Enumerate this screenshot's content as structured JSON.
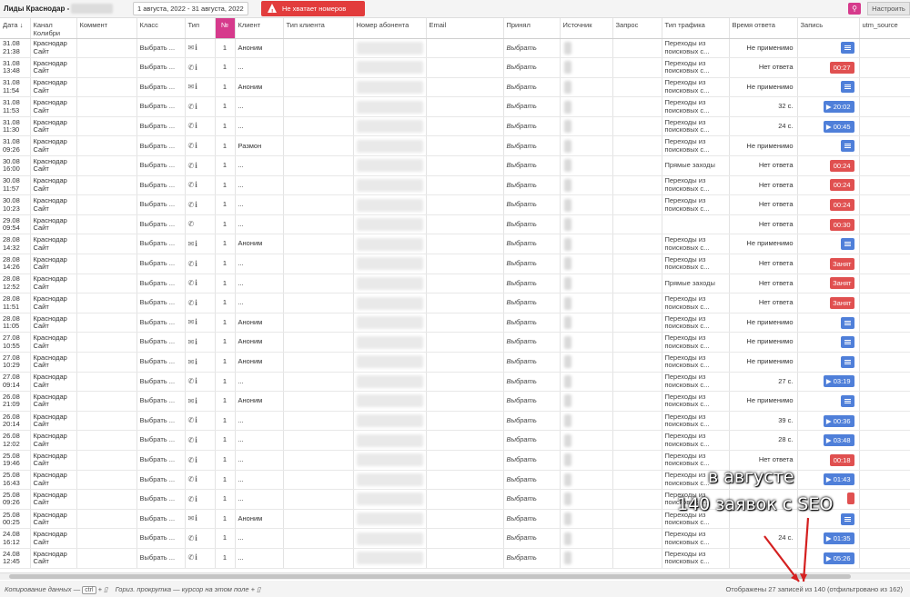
{
  "topbar": {
    "title": "Лиды Краснодар -",
    "date_range": "1 августа, 2022 - 31 августа, 2022",
    "warning": "Не хватает номеров",
    "settings": "Настроить"
  },
  "columns": [
    "Дата ↓",
    "Канал Колибри",
    "Коммент",
    "Класс",
    "Тип",
    "№",
    "Клиент",
    "Тип клиента",
    "Номер абонента",
    "Email",
    "Принял",
    "Источник",
    "Запрос",
    "Тип трафика",
    "Время ответа",
    "Запись",
    "utm_source"
  ],
  "rows": [
    {
      "date": "31.08 21:38",
      "channel": "Краснодар Сайт",
      "cls": "Выбрать ...",
      "type": "mail",
      "num": "1",
      "client": "Аноним",
      "accepted": "Выбрать",
      "traffic": "Переходы из поисковых с...",
      "resp": "Не применимо",
      "rec": {
        "kind": "note"
      },
      "red": false
    },
    {
      "date": "31.08 13:48",
      "channel": "Краснодар Сайт",
      "cls": "Выбрать ...",
      "type": "phone",
      "num": "1",
      "client": "...",
      "accepted": "Выбрать",
      "traffic": "Переходы из поисковых с...",
      "resp": "Нет ответа",
      "rec": {
        "kind": "red",
        "text": "00:27"
      },
      "red": false
    },
    {
      "date": "31.08 11:54",
      "channel": "Краснодар Сайт",
      "cls": "Выбрать ...",
      "type": "mail",
      "num": "1",
      "client": "Аноним",
      "accepted": "Выбрать",
      "traffic": "Переходы из поисковых с...",
      "resp": "Не применимо",
      "rec": {
        "kind": "note"
      },
      "red": false
    },
    {
      "date": "31.08 11:53",
      "channel": "Краснодар Сайт",
      "cls": "Выбрать ...",
      "type": "phone",
      "num": "1",
      "client": "...",
      "accepted": "Выбрать",
      "traffic": "Переходы из поисковых с...",
      "resp": "32 с.",
      "rec": {
        "kind": "play",
        "text": "20:02"
      },
      "red": true
    },
    {
      "date": "31.08 11:30",
      "channel": "Краснодар Сайт",
      "cls": "Выбрать ...",
      "type": "phone",
      "num": "1",
      "client": "...",
      "accepted": "Выбрать",
      "traffic": "Переходы из поисковых с...",
      "resp": "24 с.",
      "rec": {
        "kind": "play",
        "text": "00:45"
      },
      "red": false
    },
    {
      "date": "31.08 09:26",
      "channel": "Краснодар Сайт",
      "cls": "Выбрать ...",
      "type": "phone",
      "num": "1",
      "client": "Размон",
      "accepted": "Выбрать",
      "traffic": "Переходы из поисковых с...",
      "resp": "Не применимо",
      "rec": {
        "kind": "note"
      },
      "red": false
    },
    {
      "date": "30.08 16:00",
      "channel": "Краснодар Сайт",
      "cls": "Выбрать ...",
      "type": "phone",
      "num": "1",
      "client": "...",
      "accepted": "Выбрать",
      "traffic": "Прямые заходы",
      "resp": "Нет ответа",
      "rec": {
        "kind": "red",
        "text": "00:24"
      },
      "red": false
    },
    {
      "date": "30.08 11:57",
      "channel": "Краснодар Сайт",
      "cls": "Выбрать ...",
      "type": "phone",
      "num": "1",
      "client": "...",
      "accepted": "Выбрать",
      "traffic": "Переходы из поисковых с...",
      "resp": "Нет ответа",
      "rec": {
        "kind": "red",
        "text": "00:24"
      },
      "red": false
    },
    {
      "date": "30.08 10:23",
      "channel": "Краснодар Сайт",
      "cls": "Выбрать ...",
      "type": "phone",
      "num": "1",
      "client": "...",
      "accepted": "Выбрать",
      "traffic": "Переходы из поисковых с...",
      "resp": "Нет ответа",
      "rec": {
        "kind": "red",
        "text": "00:24"
      },
      "red": false
    },
    {
      "date": "29.08 09:54",
      "channel": "Краснодар Сайт",
      "cls": "Выбрать ...",
      "type": "phone-only",
      "num": "1",
      "client": "...",
      "accepted": "Выбрать",
      "traffic": "",
      "resp": "Нет ответа",
      "rec": {
        "kind": "red",
        "text": "00:30"
      },
      "red": false
    },
    {
      "date": "28.08 14:32",
      "channel": "Краснодар Сайт",
      "cls": "Выбрать ...",
      "type": "mail",
      "num": "1",
      "client": "Аноним",
      "accepted": "Выбрать",
      "traffic": "Переходы из поисковых с...",
      "resp": "Не применимо",
      "rec": {
        "kind": "note"
      },
      "red": false
    },
    {
      "date": "28.08 14:26",
      "channel": "Краснодар Сайт",
      "cls": "Выбрать ...",
      "type": "phone",
      "num": "1",
      "client": "...",
      "accepted": "Выбрать",
      "traffic": "Переходы из поисковых с...",
      "resp": "Нет ответа",
      "rec": {
        "kind": "busy",
        "text": "Занят"
      },
      "red": true
    },
    {
      "date": "28.08 12:52",
      "channel": "Краснодар Сайт",
      "cls": "Выбрать ...",
      "type": "phone",
      "num": "1",
      "client": "...",
      "accepted": "Выбрать",
      "traffic": "Прямые заходы",
      "resp": "Нет ответа",
      "rec": {
        "kind": "busy",
        "text": "Занят"
      },
      "red": true
    },
    {
      "date": "28.08 11:51",
      "channel": "Краснодар Сайт",
      "cls": "Выбрать ...",
      "type": "phone",
      "num": "1",
      "client": "...",
      "accepted": "Выбрать",
      "traffic": "Переходы из поисковых с...",
      "resp": "Нет ответа",
      "rec": {
        "kind": "busy",
        "text": "Занят"
      },
      "red": true
    },
    {
      "date": "28.08 11:05",
      "channel": "Краснодар Сайт",
      "cls": "Выбрать ...",
      "type": "mail",
      "num": "1",
      "client": "Аноним",
      "accepted": "Выбрать",
      "traffic": "Переходы из поисковых с...",
      "resp": "Не применимо",
      "rec": {
        "kind": "note"
      },
      "red": false
    },
    {
      "date": "27.08 10:55",
      "channel": "Краснодар Сайт",
      "cls": "Выбрать ...",
      "type": "mail",
      "num": "1",
      "client": "Аноним",
      "accepted": "Выбрать",
      "traffic": "Переходы из поисковых с...",
      "resp": "Не применимо",
      "rec": {
        "kind": "note"
      },
      "red": false
    },
    {
      "date": "27.08 10:29",
      "channel": "Краснодар Сайт",
      "cls": "Выбрать ...",
      "type": "mail",
      "num": "1",
      "client": "Аноним",
      "accepted": "Выбрать",
      "traffic": "Переходы из поисковых с...",
      "resp": "Не применимо",
      "rec": {
        "kind": "note"
      },
      "red": false
    },
    {
      "date": "27.08 09:14",
      "channel": "Краснодар Сайт",
      "cls": "Выбрать ...",
      "type": "phone",
      "num": "1",
      "client": "...",
      "accepted": "Выбрать",
      "traffic": "Переходы из поисковых с...",
      "resp": "27 с.",
      "rec": {
        "kind": "play",
        "text": "03:19"
      },
      "red": false
    },
    {
      "date": "26.08 21:09",
      "channel": "Краснодар Сайт",
      "cls": "Выбрать ...",
      "type": "mail",
      "num": "1",
      "client": "Аноним",
      "accepted": "Выбрать",
      "traffic": "Переходы из поисковых с...",
      "resp": "Не применимо",
      "rec": {
        "kind": "note"
      },
      "red": false
    },
    {
      "date": "26.08 20:14",
      "channel": "Краснодар Сайт",
      "cls": "Выбрать ...",
      "type": "phone",
      "num": "1",
      "client": "...",
      "accepted": "Выбрать",
      "traffic": "Переходы из поисковых с...",
      "resp": "39 с.",
      "rec": {
        "kind": "play",
        "text": "00:36"
      },
      "red": false
    },
    {
      "date": "26.08 12:02",
      "channel": "Краснодар Сайт",
      "cls": "Выбрать ...",
      "type": "phone",
      "num": "1",
      "client": "...",
      "accepted": "Выбрать",
      "traffic": "Переходы из поисковых с...",
      "resp": "28 с.",
      "rec": {
        "kind": "play",
        "text": "03:48"
      },
      "red": true
    },
    {
      "date": "25.08 19:46",
      "channel": "Краснодар Сайт",
      "cls": "Выбрать ...",
      "type": "phone",
      "num": "1",
      "client": "...",
      "accepted": "Выбрать",
      "traffic": "Переходы из поисковых с...",
      "resp": "Нет ответа",
      "rec": {
        "kind": "red",
        "text": "00:18"
      },
      "red": true
    },
    {
      "date": "25.08 16:43",
      "channel": "Краснодар Сайт",
      "cls": "Выбрать ...",
      "type": "phone",
      "num": "1",
      "client": "...",
      "accepted": "Выбрать",
      "traffic": "Переходы из поисковых с...",
      "resp": "",
      "rec": {
        "kind": "play",
        "text": "01:43"
      },
      "red": false
    },
    {
      "date": "25.08 09:26",
      "channel": "Краснодар Сайт",
      "cls": "Выбрать ...",
      "type": "phone",
      "num": "1",
      "client": "...",
      "accepted": "Выбрать",
      "traffic": "Переходы из поисковых с...",
      "resp": "",
      "rec": {
        "kind": "red",
        "text": ""
      },
      "red": true
    },
    {
      "date": "25.08 00:25",
      "channel": "Краснодар Сайт",
      "cls": "Выбрать ...",
      "type": "mail",
      "num": "1",
      "client": "Аноним",
      "accepted": "Выбрать",
      "traffic": "Переходы из поисковых с...",
      "resp": "",
      "rec": {
        "kind": "note"
      },
      "red": false
    },
    {
      "date": "24.08 16:12",
      "channel": "Краснодар Сайт",
      "cls": "Выбрать ...",
      "type": "phone",
      "num": "1",
      "client": "...",
      "accepted": "Выбрать",
      "traffic": "Переходы из поисковых с...",
      "resp": "24 с.",
      "rec": {
        "kind": "play",
        "text": "01:35"
      },
      "red": true
    },
    {
      "date": "24.08 12:45",
      "channel": "Краснодар Сайт",
      "cls": "Выбрать ...",
      "type": "phone",
      "num": "1",
      "client": "...",
      "accepted": "Выбрать",
      "traffic": "Переходы из поисковых с...",
      "resp": "",
      "rec": {
        "kind": "play",
        "text": "05:26"
      },
      "red": true
    }
  ],
  "footer": {
    "copy_hint_prefix": "Копирование данных —",
    "copy_key": "ctrl",
    "scroll_hint": "Гориз. прокрутка — курсор на этом поле +",
    "counter": "Отображены 27 записей из 140 (отфильтровано из 162)"
  },
  "annotation": {
    "line1": "в августе",
    "line2": "140 заявок с SEO",
    "color": "#d42020"
  },
  "colors": {
    "accent_pink": "#d63a8c",
    "warning_red": "#e23c3c",
    "play_blue": "#4f7fd9",
    "recording_red": "#e05050"
  }
}
